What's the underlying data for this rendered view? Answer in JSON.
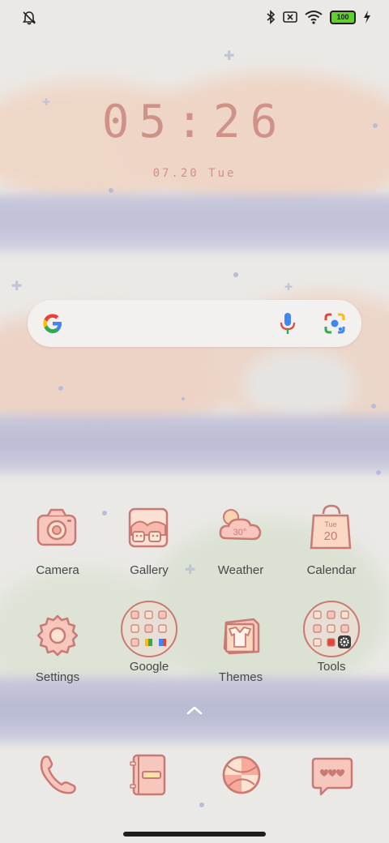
{
  "status_bar": {
    "battery": "100",
    "icons": [
      "notifications-off-icon",
      "bluetooth-icon",
      "no-sim-icon",
      "wifi-icon",
      "battery-icon",
      "charging-bolt-icon"
    ]
  },
  "clock": {
    "time": "05:26",
    "date": "07.20  Tue"
  },
  "search": {
    "icons": [
      "google-g-icon",
      "mic-icon",
      "lens-icon"
    ]
  },
  "apps": [
    {
      "label": "Camera",
      "icon": "camera-icon"
    },
    {
      "label": "Gallery",
      "icon": "gallery-icon"
    },
    {
      "label": "Weather",
      "icon": "weather-icon",
      "badge": "30°"
    },
    {
      "label": "Calendar",
      "icon": "calendar-icon",
      "day": "Tue",
      "date_num": "20"
    },
    {
      "label": "Settings",
      "icon": "settings-icon"
    },
    {
      "label": "Google",
      "icon": "google-folder-icon"
    },
    {
      "label": "Themes",
      "icon": "themes-icon"
    },
    {
      "label": "Tools",
      "icon": "tools-folder-icon"
    }
  ],
  "dock": [
    {
      "icon": "phone-icon"
    },
    {
      "icon": "contacts-icon"
    },
    {
      "icon": "browser-icon"
    },
    {
      "icon": "messages-icon"
    }
  ],
  "colors": {
    "icon_fill": "#f7c6bd",
    "icon_stroke": "#c97a74",
    "clock": "#cf9289",
    "label": "#474747"
  }
}
